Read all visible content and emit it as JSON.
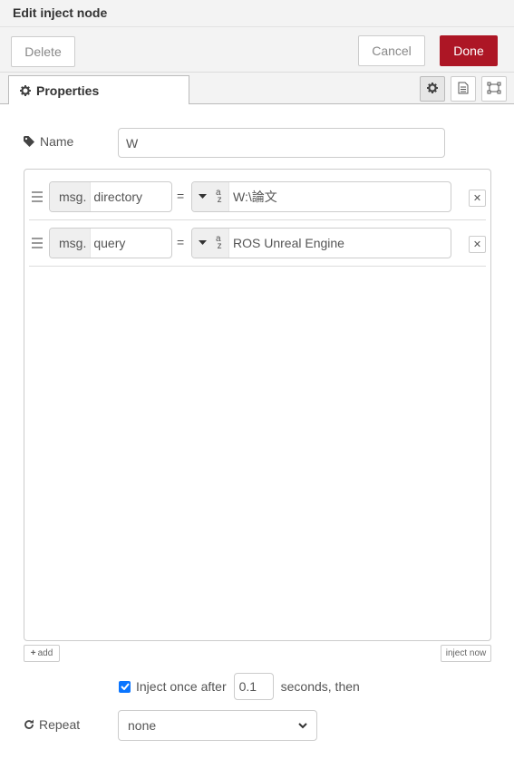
{
  "dialog": {
    "title": "Edit inject node"
  },
  "toolbar": {
    "delete_label": "Delete",
    "cancel_label": "Cancel",
    "done_label": "Done"
  },
  "tabs": {
    "properties_label": "Properties"
  },
  "form": {
    "name_label": "Name",
    "name_value": "W",
    "rows": [
      {
        "prefix": "msg.",
        "property": "directory",
        "equals": "=",
        "type_icon": "az-string-icon",
        "value": "W:\\論文"
      },
      {
        "prefix": "msg.",
        "property": "query",
        "equals": "=",
        "type_icon": "az-string-icon",
        "value": "ROS Unreal Engine"
      }
    ],
    "add_label": "add",
    "inject_now_label": "inject now",
    "inject_once_label": "Inject once after",
    "inject_once_checked": true,
    "seconds_value": "0.1",
    "seconds_suffix": "seconds, then",
    "repeat_label": "Repeat",
    "repeat_value": "none"
  },
  "colors": {
    "done": "#ad1625",
    "checkbox": "#0a75ff"
  }
}
